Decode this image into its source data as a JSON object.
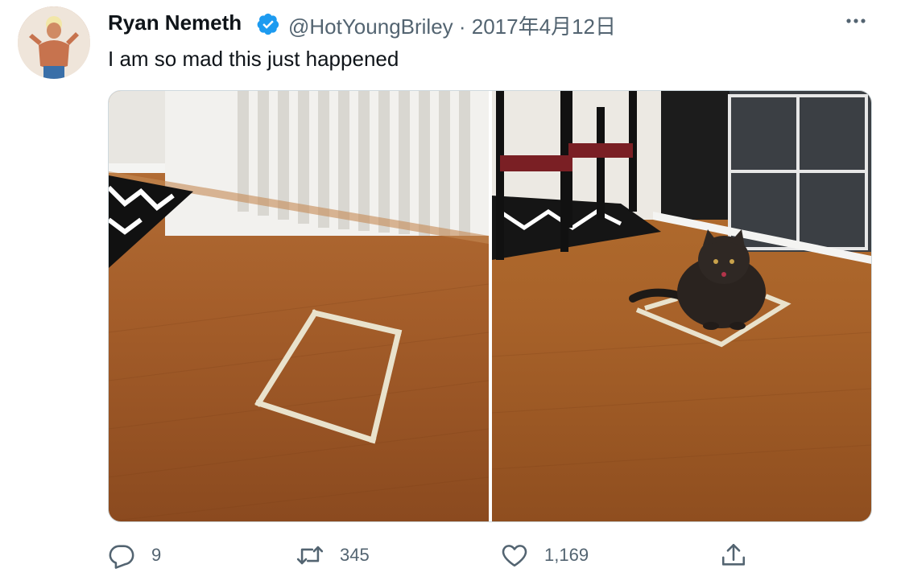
{
  "tweet": {
    "author_name": "Ryan Nemeth",
    "author_handle_and_date": "@HotYoungBriley · 2017年4月12日",
    "text": "I am so mad this just happened",
    "verified": true
  },
  "actions": {
    "replies": "9",
    "retweets": "345",
    "likes": "1,169"
  },
  "colors": {
    "verified_blue": "#1d9bf0",
    "muted_text": "#536471",
    "primary_text": "#0f1419"
  },
  "icons": [
    "avatar",
    "verified-badge-icon",
    "more-icon",
    "reply-icon",
    "retweet-icon",
    "like-icon",
    "share-icon"
  ]
}
